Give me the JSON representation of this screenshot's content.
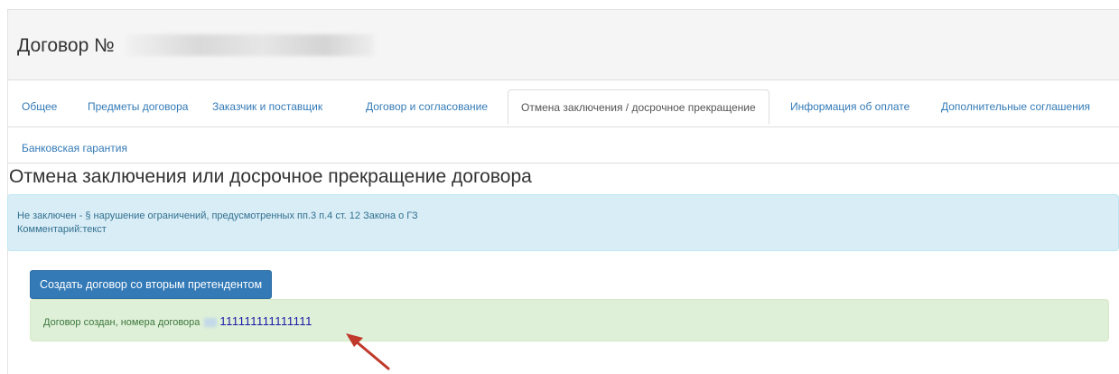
{
  "header": {
    "title": "Договор №"
  },
  "tabs": [
    {
      "label": "Общее"
    },
    {
      "label": "Предметы договора"
    },
    {
      "label": "Заказчик и поставщик"
    },
    {
      "label": "Договор и согласование"
    },
    {
      "label": "Отмена заключения / досрочное прекращение",
      "active": true
    },
    {
      "label": "Информация об оплате"
    },
    {
      "label": "Дополнительные соглашения"
    },
    {
      "label": "Банковская гарантия"
    }
  ],
  "section": {
    "title": "Отмена заключения или досрочное прекращение договора"
  },
  "info_alert": {
    "line1": "Не заключен - § нарушение ограничений, предусмотренных пп.3 п.4 ст. 12 Закона о ГЗ",
    "line2": "Комментарий:текст"
  },
  "actions": {
    "create_button_label": "Создать договор со вторым претендентом"
  },
  "success_alert": {
    "text": "Договор создан, номера договора",
    "contract_number": "111111111111111"
  },
  "colors": {
    "link": "#337ab7",
    "primary": "#337ab7",
    "info_bg": "#d9edf7",
    "success_bg": "#dff0d8",
    "arrow": "#c0392b"
  }
}
